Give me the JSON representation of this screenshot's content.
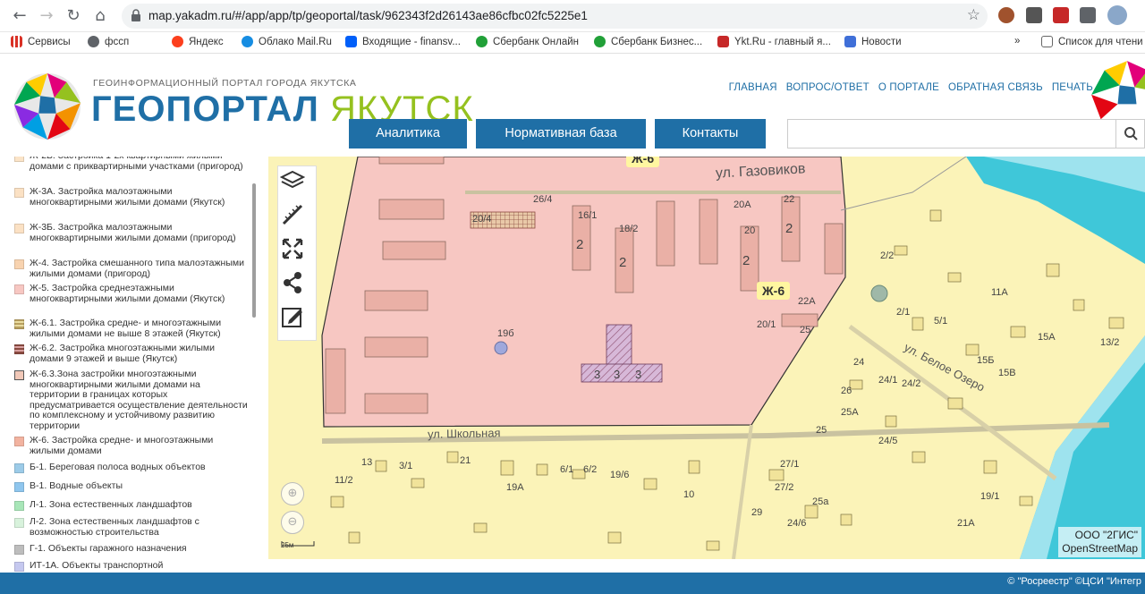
{
  "browser": {
    "url": "map.yakadm.ru/#/app/app/tp/geoportal/task/962343f2d26143ae86cfbc02fc5225e1",
    "bookmarks": [
      {
        "label": "Сервисы",
        "color": "#d93025"
      },
      {
        "label": "фссп",
        "color": "#5f6368"
      },
      {
        "label": "Яндекс",
        "color": "#fc3f1d"
      },
      {
        "label": "Облако Mail.Ru",
        "color": "#168de2"
      },
      {
        "label": "Входящие - finansv...",
        "color": "#005ff9"
      },
      {
        "label": "Сбербанк Онлайн",
        "color": "#21a038"
      },
      {
        "label": "Сбербанк Бизнес...",
        "color": "#21a038"
      },
      {
        "label": "Ykt.Ru - главный я...",
        "color": "#c62828"
      },
      {
        "label": "Новости",
        "color": "#3f6fd8"
      }
    ],
    "overflow": "»",
    "reading_list": "Список для чтени"
  },
  "site": {
    "subtitle": "ГЕОИНФОРМАЦИОННЫЙ ПОРТАЛ ГОРОДА ЯКУТСКА",
    "title_a": "ГЕОПОРТАЛ",
    "title_b": "ЯКУТСК",
    "toplinks": [
      "ГЛАВНАЯ",
      "ВОПРОС/ОТВЕТ",
      "О ПОРТАЛЕ",
      "ОБРАТНАЯ СВЯЗЬ",
      "ПЕЧАТЬ"
    ],
    "menu": [
      "Аналитика",
      "Нормативная база",
      "Контакты"
    ],
    "search_placeholder": ""
  },
  "legend": [
    {
      "text": "Ж-2Б. Застройка 1-2х квартирными жилыми домами с приквартирными участками (пригород)",
      "color": "#fbe4c8"
    },
    {
      "text": "Ж-3А. Застройка малоэтажными многоквартирными жилыми домами (Якутск)",
      "color": "#fbe1c4"
    },
    {
      "text": "Ж-3Б. Застройка малоэтажными многоквартирными жилыми домами (пригород)",
      "color": "#fbe1c4"
    },
    {
      "text": "Ж-4. Застройка смешанного типа малоэтажными жилыми домами (пригород)",
      "color": "#f8d3b0"
    },
    {
      "text": "Ж-5. Застройка среднеэтажными многоквартирными жилыми домами (Якутск)",
      "color": "#f7c7c2"
    },
    {
      "text": "Ж-6.1. Застройка средне- и многоэтажными жилыми домами не выше 8 этажей (Якутск)",
      "color": "#b9a060"
    },
    {
      "text": "Ж-6.2. Застройка многоэтажными жилыми домами 9 этажей и выше (Якутск)",
      "color": "#8a4a40"
    },
    {
      "text": "Ж-6.3.Зона застройки многоэтажными многоквартирными жилыми домами на территории в границах которых предусматривается осуществление деятельности по комплексному и устойчивому развитию территории",
      "color": "#f1c8b8"
    },
    {
      "text": "Ж-6. Застройка средне- и многоэтажными жилыми домами",
      "color": "#f2b3a0"
    },
    {
      "text": "Б-1. Береговая полоса водных объектов",
      "color": "#9ccbe8"
    },
    {
      "text": "В-1. Водные объекты",
      "color": "#8fc6ee"
    },
    {
      "text": "Л-1. Зона естественных ландшафтов",
      "color": "#a8e6b8"
    },
    {
      "text": "Л-2. Зона естественных ландшафтов с возможностью строительства",
      "color": "#d8f2dc"
    },
    {
      "text": "Г-1. Объекты гаражного назначения",
      "color": "#bdbdbd"
    },
    {
      "text": "ИТ-1А. Объекты транспортной",
      "color": "#c5c8ef"
    }
  ],
  "map": {
    "streets": [
      "ул. Газовиков",
      "ул. Школьная",
      "ул. Белое Озеро"
    ],
    "zones": [
      "Ж-6",
      "Ж-6"
    ],
    "lot_numbers": [
      "26/4",
      "16/1",
      "18/2",
      "20А",
      "22",
      "20/4",
      "20",
      "22А",
      "20/1",
      "25",
      "19б",
      "2/2",
      "2/1",
      "5/1",
      "11А",
      "15А",
      "15Б",
      "15В",
      "13/2",
      "24",
      "24/1",
      "24/2",
      "26",
      "25А",
      "25",
      "24/5",
      "3/1",
      "6/1",
      "6/2",
      "19/6",
      "19А",
      "11/2",
      "13",
      "21",
      "10",
      "27/1",
      "27/2",
      "29",
      "24/6",
      "25а",
      "21А",
      "19/1",
      "2",
      "2",
      "2",
      "2",
      "3",
      "3",
      "3"
    ],
    "attribution_1": "ООО \"2ГИС\"",
    "attribution_2": "OpenStreetMap",
    "scale": "25м",
    "zoom_in": "⊕",
    "zoom_out": "⊖"
  },
  "footer": {
    "text": "© \"Росреестр\" ©ЦСИ \"Интегр"
  }
}
